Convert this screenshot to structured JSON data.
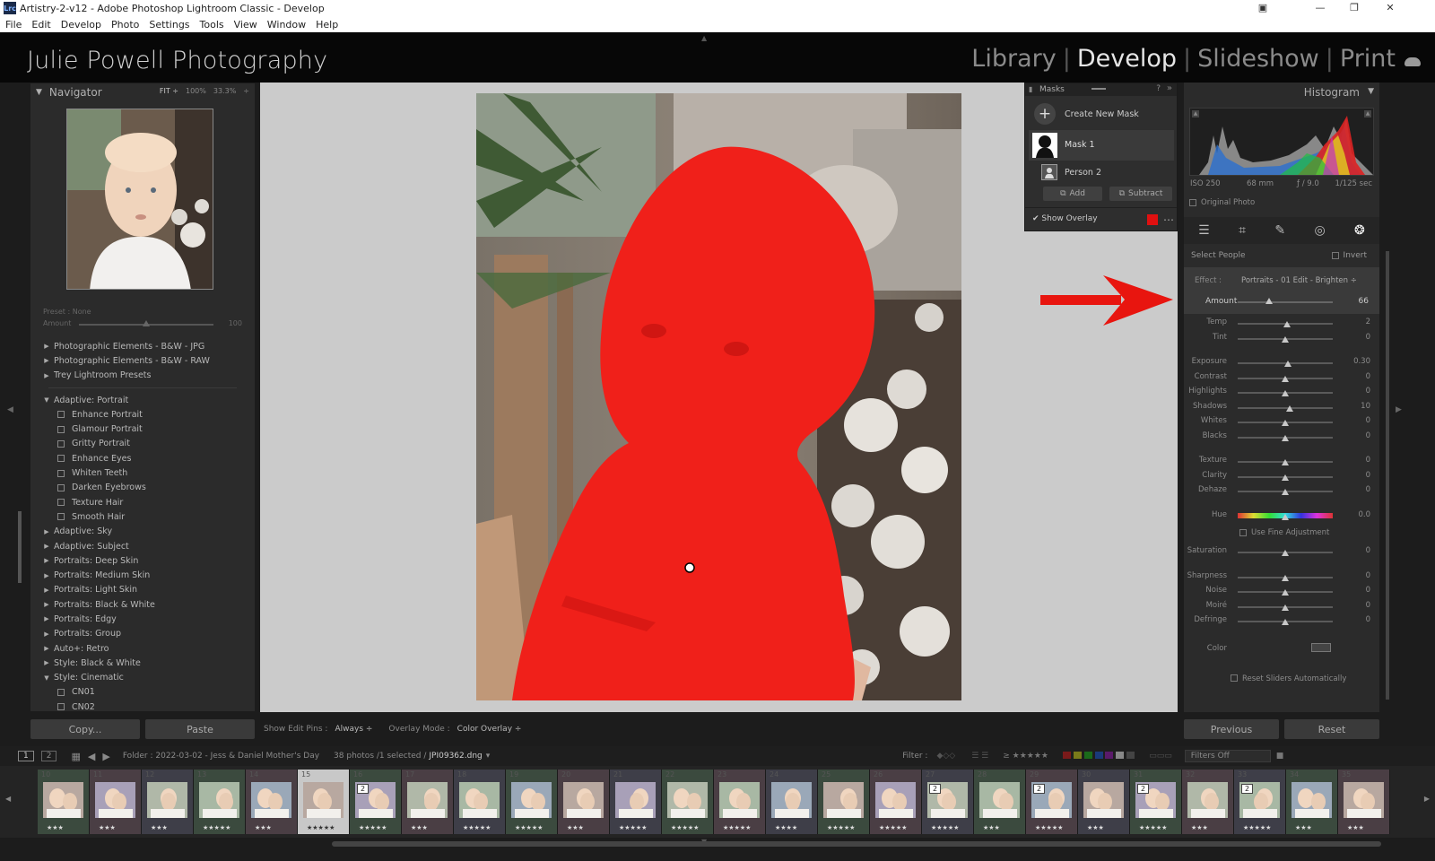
{
  "window": {
    "title": "Artistry-2-v12 - Adobe Photoshop Lightroom Classic - Develop",
    "app_icon": "Lrc"
  },
  "menu": [
    "File",
    "Edit",
    "Develop",
    "Photo",
    "Settings",
    "Tools",
    "View",
    "Window",
    "Help"
  ],
  "identity_plate": "Julie Powell Photography",
  "modules": [
    {
      "label": "Library"
    },
    {
      "label": "Develop",
      "active": true
    },
    {
      "label": "Slideshow"
    },
    {
      "label": "Print"
    }
  ],
  "navigator": {
    "title": "Navigator",
    "fit": "FIT ÷",
    "zoom100": "100%",
    "zoom333": "33.3%"
  },
  "preset_amount": {
    "preset_label": "Preset :",
    "preset_value": "None",
    "amount_label": "Amount",
    "amount_value": "100",
    "level": 0.5
  },
  "presets": [
    {
      "label": "Photographic Elements - B&W - JPG",
      "kind": "group",
      "open": false
    },
    {
      "label": "Photographic Elements - B&W - RAW",
      "kind": "group",
      "open": false
    },
    {
      "label": "Trey Lightroom Presets",
      "kind": "group",
      "open": false
    },
    {
      "kind": "divider"
    },
    {
      "label": "Adaptive: Portrait",
      "kind": "group",
      "open": true
    },
    {
      "label": "Enhance Portrait",
      "kind": "child"
    },
    {
      "label": "Glamour Portrait",
      "kind": "child"
    },
    {
      "label": "Gritty Portrait",
      "kind": "child"
    },
    {
      "label": "Enhance Eyes",
      "kind": "child"
    },
    {
      "label": "Whiten Teeth",
      "kind": "child"
    },
    {
      "label": "Darken Eyebrows",
      "kind": "child"
    },
    {
      "label": "Texture Hair",
      "kind": "child"
    },
    {
      "label": "Smooth Hair",
      "kind": "child"
    },
    {
      "label": "Adaptive: Sky",
      "kind": "group",
      "open": false
    },
    {
      "label": "Adaptive: Subject",
      "kind": "group",
      "open": false
    },
    {
      "label": "Portraits: Deep Skin",
      "kind": "group",
      "open": false
    },
    {
      "label": "Portraits: Medium Skin",
      "kind": "group",
      "open": false
    },
    {
      "label": "Portraits: Light Skin",
      "kind": "group",
      "open": false
    },
    {
      "label": "Portraits: Black & White",
      "kind": "group",
      "open": false
    },
    {
      "label": "Portraits: Edgy",
      "kind": "group",
      "open": false
    },
    {
      "label": "Portraits: Group",
      "kind": "group",
      "open": false
    },
    {
      "label": "Auto+: Retro",
      "kind": "group",
      "open": false
    },
    {
      "label": "Style: Black & White",
      "kind": "group",
      "open": false
    },
    {
      "label": "Style: Cinematic",
      "kind": "group",
      "open": true
    },
    {
      "label": "CN01",
      "kind": "child"
    },
    {
      "label": "CN02",
      "kind": "child"
    }
  ],
  "left_buttons": {
    "copy": "Copy...",
    "paste": "Paste"
  },
  "toolbar": {
    "edit_pins_label": "Show Edit Pins :",
    "edit_pins_value": "Always ÷",
    "overlay_label": "Overlay Mode :",
    "overlay_value": "Color Overlay ÷"
  },
  "masks": {
    "title": "Masks",
    "create": "Create New Mask",
    "mask1": "Mask 1",
    "person": "Person 2",
    "add": "Add",
    "subtract": "Subtract",
    "show_overlay": "Show Overlay",
    "overlay_color": "#e01010"
  },
  "histogram": {
    "title": "Histogram",
    "iso": "ISO 250",
    "focal": "68 mm",
    "aperture": "ƒ / 9.0",
    "shutter": "1/125 sec",
    "original_photo": "Original Photo"
  },
  "mask_panel": {
    "select_label": "Select People",
    "invert": "Invert",
    "effect_label": "Effect :",
    "effect_value": "Portraits - 01 Edit - Brighten ÷",
    "amount_label": "Amount",
    "amount_value": "66",
    "amount_level": 0.33
  },
  "sliders": [
    {
      "label": "Temp",
      "value": "2",
      "level": 0.52
    },
    {
      "label": "Tint",
      "value": "0",
      "level": 0.5
    },
    {
      "gap": true
    },
    {
      "label": "Exposure",
      "value": "0.30",
      "level": 0.53
    },
    {
      "label": "Contrast",
      "value": "0",
      "level": 0.5
    },
    {
      "label": "Highlights",
      "value": "0",
      "level": 0.5
    },
    {
      "label": "Shadows",
      "value": "10",
      "level": 0.55
    },
    {
      "label": "Whites",
      "value": "0",
      "level": 0.5
    },
    {
      "label": "Blacks",
      "value": "0",
      "level": 0.5
    },
    {
      "gap": true
    },
    {
      "label": "Texture",
      "value": "0",
      "level": 0.5
    },
    {
      "label": "Clarity",
      "value": "0",
      "level": 0.5
    },
    {
      "label": "Dehaze",
      "value": "0",
      "level": 0.5
    },
    {
      "gap": true
    },
    {
      "label": "Hue",
      "value": "0.0",
      "level": 0.5,
      "hue": true
    }
  ],
  "fine_adjust": "Use Fine Adjustment",
  "sliders2": [
    {
      "label": "Saturation",
      "value": "0",
      "level": 0.5
    },
    {
      "gap": true
    },
    {
      "label": "Sharpness",
      "value": "0",
      "level": 0.5
    },
    {
      "label": "Noise",
      "value": "0",
      "level": 0.5
    },
    {
      "label": "Moiré",
      "value": "0",
      "level": 0.5
    },
    {
      "label": "Defringe",
      "value": "0",
      "level": 0.5
    },
    {
      "gap": true
    }
  ],
  "color_label": "Color",
  "reset_sliders": "Reset Sliders Automatically",
  "right_buttons": {
    "previous": "Previous",
    "reset": "Reset"
  },
  "filmstrip_bar": {
    "screen1": "1",
    "screen2": "2",
    "folder": "Folder : 2022-03-02 - Jess & Daniel Mother's Day",
    "count": "38 photos /1 selected /",
    "filename": "JPI09362.dng",
    "filter_label": "Filter :",
    "filters_off": "Filters Off"
  },
  "filmstrip": [
    {
      "num": "10",
      "stars": "★★★"
    },
    {
      "num": "11",
      "stars": "★★★"
    },
    {
      "num": "12",
      "stars": "★★★"
    },
    {
      "num": "13",
      "stars": "★★★★★"
    },
    {
      "num": "14",
      "stars": "★★★"
    },
    {
      "num": "15",
      "stars": "★★★★★",
      "selected": true
    },
    {
      "num": "16",
      "stars": "★★★★★",
      "badge": "2"
    },
    {
      "num": "17",
      "stars": "★★★"
    },
    {
      "num": "18",
      "stars": "★★★★★"
    },
    {
      "num": "19",
      "stars": "★★★★★"
    },
    {
      "num": "20",
      "stars": "★★★"
    },
    {
      "num": "21",
      "stars": "★★★★★"
    },
    {
      "num": "22",
      "stars": "★★★★★"
    },
    {
      "num": "23",
      "stars": "★★★★★"
    },
    {
      "num": "24",
      "stars": "★★★★"
    },
    {
      "num": "25",
      "stars": "★★★★★"
    },
    {
      "num": "26",
      "stars": "★★★★★"
    },
    {
      "num": "27",
      "stars": "★★★★★",
      "badge": "2"
    },
    {
      "num": "28",
      "stars": "★★★"
    },
    {
      "num": "29",
      "stars": "★★★★★",
      "badge": "2"
    },
    {
      "num": "30",
      "stars": "★★★"
    },
    {
      "num": "31",
      "stars": "★★★★★",
      "badge": "2"
    },
    {
      "num": "32",
      "stars": "★★★"
    },
    {
      "num": "33",
      "stars": "★★★★★",
      "badge": "2"
    },
    {
      "num": "34",
      "stars": "★★★"
    },
    {
      "num": "35",
      "stars": "★★★"
    }
  ],
  "colors": {
    "mask_red": "#f0201a",
    "arrow_red": "#e8150f",
    "panel": "#2b2b2b",
    "canvas": "#cbcbcb"
  }
}
